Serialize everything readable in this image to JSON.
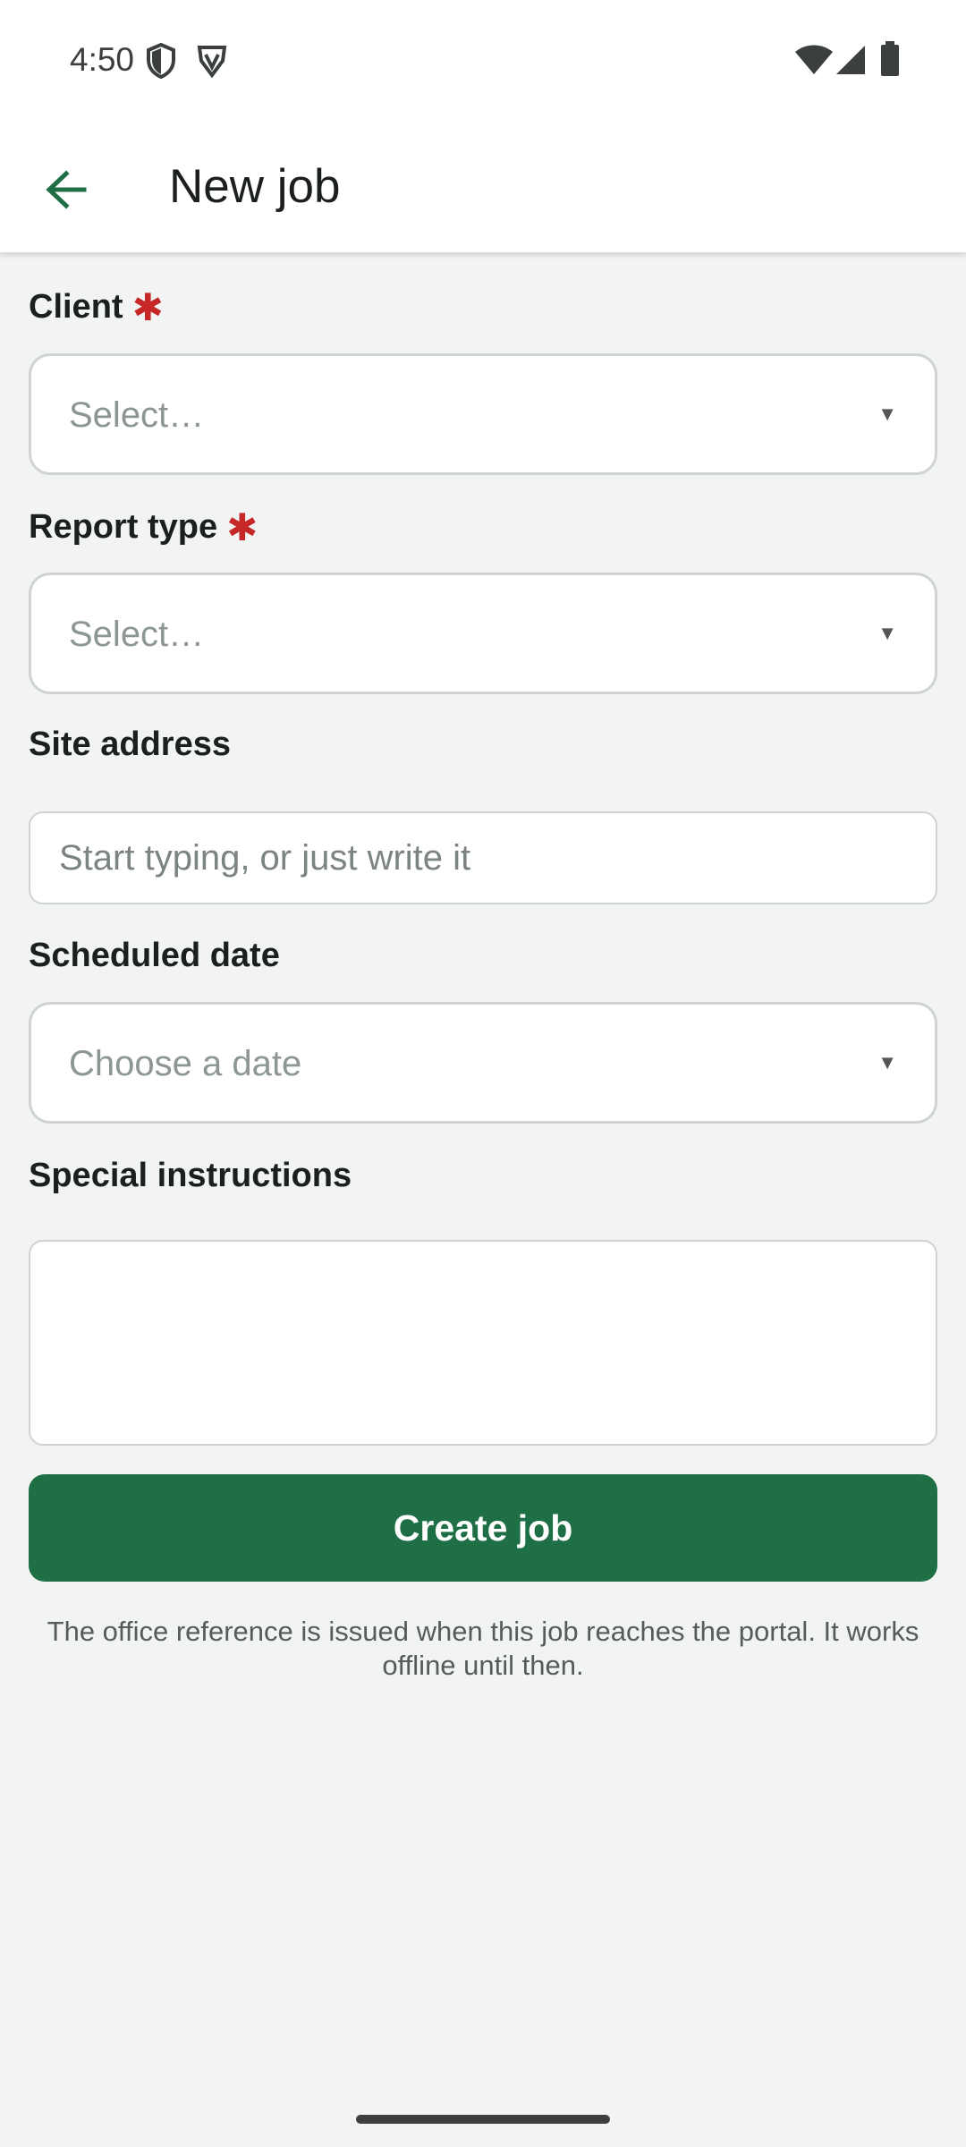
{
  "status_bar": {
    "time": "4:50",
    "left_icons": [
      "shield-icon",
      "vpn-badge-icon"
    ],
    "right_icons": [
      "wifi-icon",
      "cell-signal-icon",
      "battery-icon"
    ]
  },
  "app_bar": {
    "back_icon": "arrow-left-icon",
    "title": "New job"
  },
  "form": {
    "client": {
      "label": "Client",
      "required_mark": "✱",
      "placeholder": "Select…"
    },
    "report_type": {
      "label": "Report type",
      "required_mark": "✱",
      "placeholder": "Select…"
    },
    "site_address": {
      "label": "Site address",
      "placeholder": "Start typing, or just write it",
      "value": ""
    },
    "scheduled_date": {
      "label": "Scheduled date",
      "placeholder": "Choose a date"
    },
    "special_instructions": {
      "label": "Special instructions",
      "value": ""
    },
    "create_button": "Create job",
    "helper_text": "The office reference is issued when this job reaches the portal. It works offline until then.",
    "caret": "▼"
  },
  "colors": {
    "accent": "#1e6e46",
    "required": "#c62828",
    "background": "#f2f4f3"
  }
}
